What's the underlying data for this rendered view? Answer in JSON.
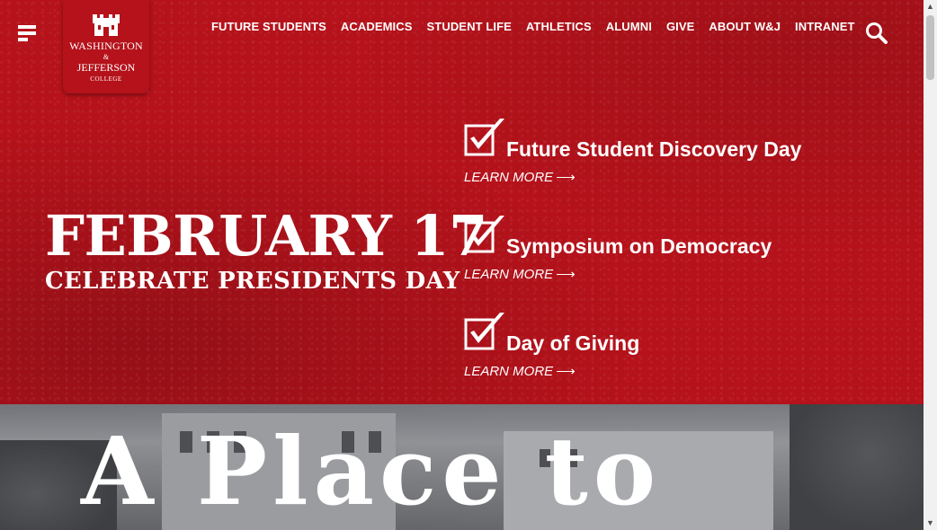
{
  "logo": {
    "line1": "WASHINGTON",
    "amp": "&",
    "line2": "JEFFERSON",
    "line3": "COLLEGE"
  },
  "nav": [
    {
      "label": "FUTURE STUDENTS"
    },
    {
      "label": "ACADEMICS"
    },
    {
      "label": "STUDENT LIFE"
    },
    {
      "label": "ATHLETICS"
    },
    {
      "label": "ALUMNI"
    },
    {
      "label": "GIVE"
    },
    {
      "label": "ABOUT W&J"
    },
    {
      "label": "INTRANET"
    }
  ],
  "hero": {
    "date": "FEBRUARY 17",
    "subtitle": "CELEBRATE PRESIDENTS DAY"
  },
  "events": [
    {
      "title": "Future Student Discovery Day",
      "link": "LEARN MORE"
    },
    {
      "title": "Symposium on Democracy",
      "link": "LEARN MORE"
    },
    {
      "title": "Day of Giving",
      "link": "LEARN MORE"
    }
  ],
  "campus": {
    "heading": "A Place to"
  },
  "icons": {
    "menu": "hamburger-menu-icon",
    "search": "search-icon",
    "check": "checkbox-icon",
    "arrow": "right-arrow-icon"
  },
  "colors": {
    "brand": "#b5121b",
    "text": "#ffffff"
  }
}
